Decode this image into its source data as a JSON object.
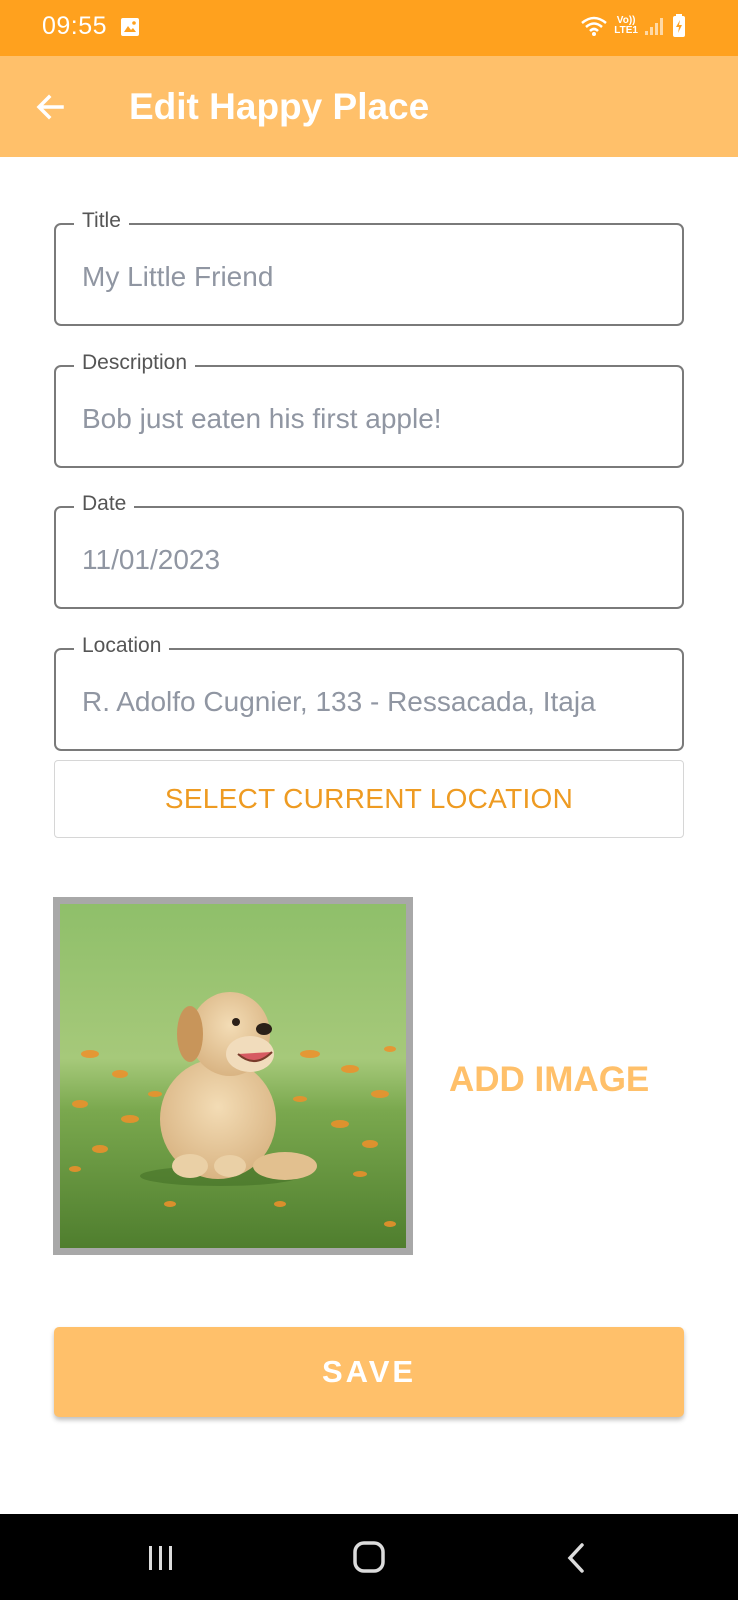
{
  "status_bar": {
    "time": "09:55",
    "network_top": "Vo))",
    "network_bottom": "LTE1",
    "icons": [
      "gallery-icon",
      "wifi-icon",
      "signal-icon",
      "battery-icon"
    ]
  },
  "app_bar": {
    "title": "Edit Happy Place",
    "back_icon": "arrow-left-icon"
  },
  "form": {
    "title": {
      "label": "Title",
      "value": "My Little Friend"
    },
    "description": {
      "label": "Description",
      "value": "Bob just eaten his first apple!"
    },
    "date": {
      "label": "Date",
      "value": "11/01/2023"
    },
    "location": {
      "label": "Location",
      "value": "R. Adolfo Cugnier, 133 - Ressacada, Itaja"
    },
    "select_location_label": "SELECT CURRENT LOCATION",
    "add_image_label": "ADD IMAGE",
    "save_label": "SAVE"
  },
  "colors": {
    "status_bar": "#FFA11E",
    "accent": "#FFC06A",
    "accent_text": "#EE9B22",
    "value_text": "#9096A2"
  },
  "nav_bar": {
    "icons": [
      "recents-icon",
      "home-icon",
      "back-icon"
    ]
  }
}
